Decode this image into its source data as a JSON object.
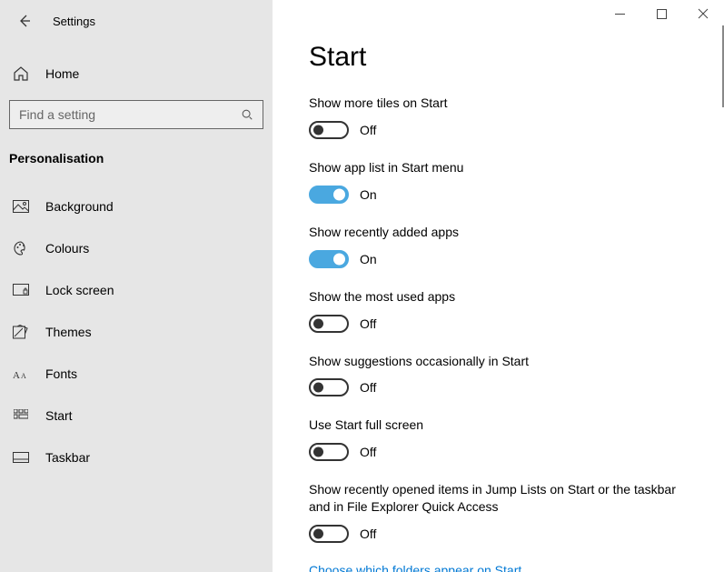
{
  "header": {
    "app_title": "Settings"
  },
  "sidebar": {
    "home_label": "Home",
    "search_placeholder": "Find a setting",
    "category": "Personalisation",
    "items": [
      {
        "label": "Background"
      },
      {
        "label": "Colours"
      },
      {
        "label": "Lock screen"
      },
      {
        "label": "Themes"
      },
      {
        "label": "Fonts"
      },
      {
        "label": "Start"
      },
      {
        "label": "Taskbar"
      }
    ]
  },
  "main": {
    "title": "Start",
    "settings": [
      {
        "label": "Show more tiles on Start",
        "value": false,
        "value_text": "Off"
      },
      {
        "label": "Show app list in Start menu",
        "value": true,
        "value_text": "On"
      },
      {
        "label": "Show recently added apps",
        "value": true,
        "value_text": "On"
      },
      {
        "label": "Show the most used apps",
        "value": false,
        "value_text": "Off"
      },
      {
        "label": "Show suggestions occasionally in Start",
        "value": false,
        "value_text": "Off"
      },
      {
        "label": "Use Start full screen",
        "value": false,
        "value_text": "Off"
      },
      {
        "label": "Show recently opened items in Jump Lists on Start or the taskbar and in File Explorer Quick Access",
        "value": false,
        "value_text": "Off"
      }
    ],
    "link": "Choose which folders appear on Start"
  }
}
